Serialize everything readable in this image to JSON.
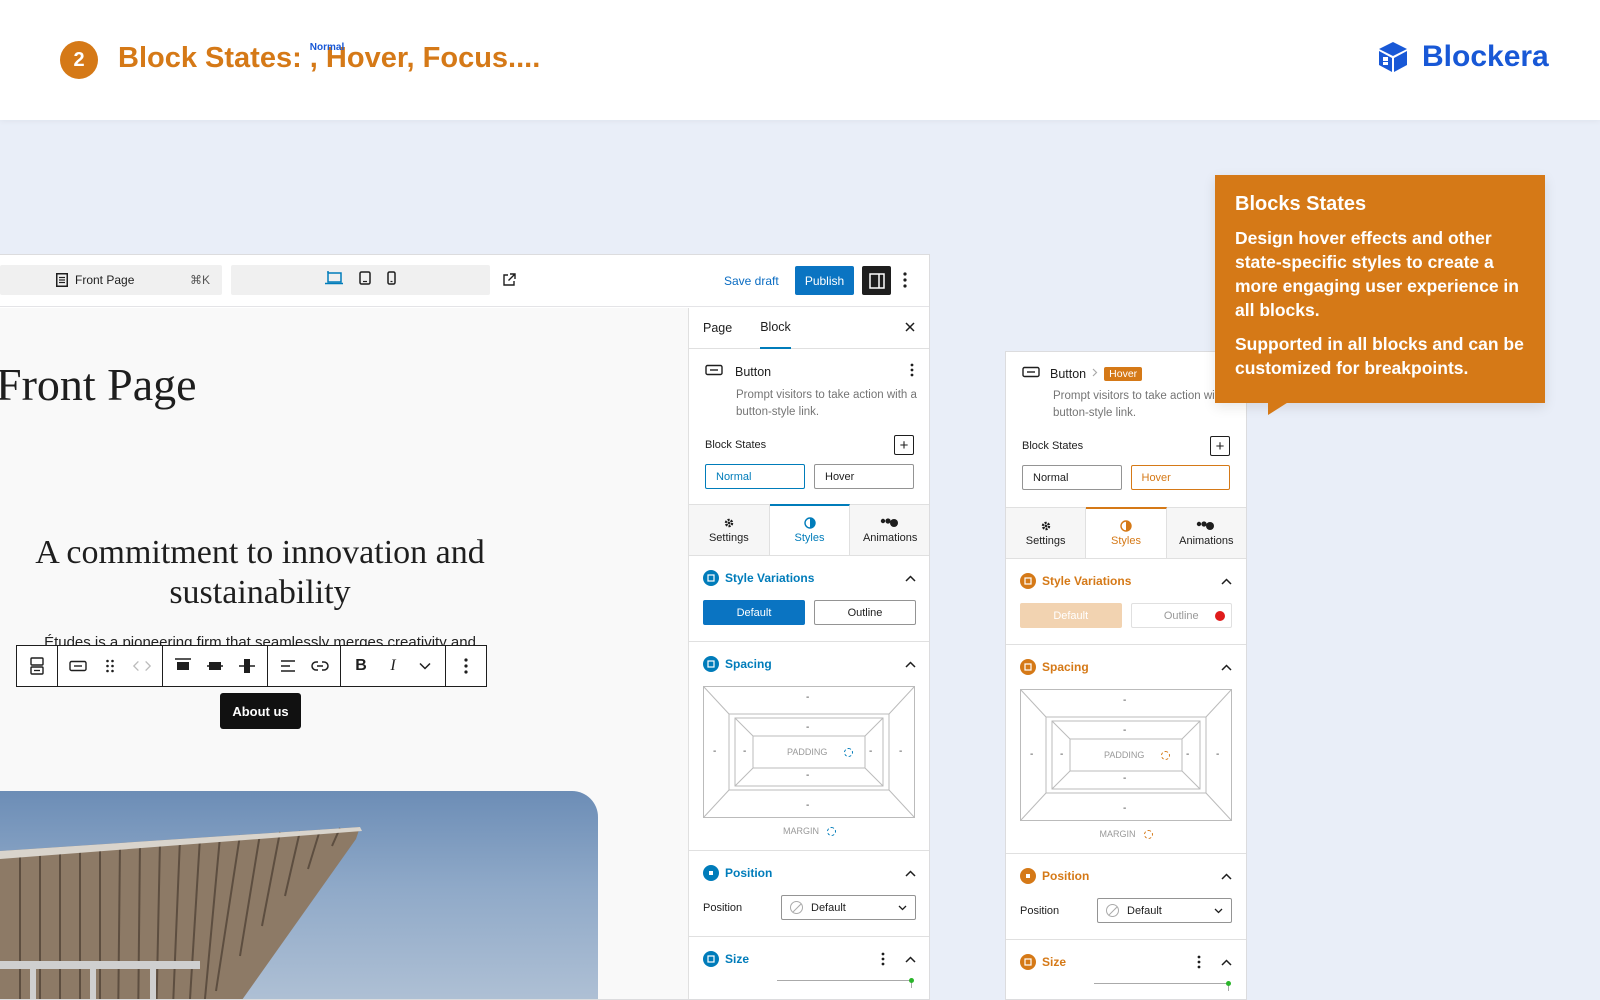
{
  "header": {
    "step": "2",
    "title_prefix": "Block States: ",
    "title_normal": "Normal",
    "comma1": ", ",
    "title_hover": "Hover",
    "comma2": ", ",
    "title_focus": "Focus....",
    "brand": "Blockera"
  },
  "topbar": {
    "command_label": "Front Page",
    "shortcut": "⌘K",
    "save_draft": "Save draft",
    "publish": "Publish"
  },
  "canvas": {
    "page_title": "Front Page",
    "tagline": "A commitment to innovation and sustainability",
    "paragraph": "Études is a pioneering firm that seamlessly merges creativity and",
    "button_label": "About us",
    "toolbar_bold": "B",
    "toolbar_italic": "I"
  },
  "inspector": {
    "tab_page": "Page",
    "tab_block": "Block",
    "block_name": "Button",
    "block_desc": "Prompt visitors to take action with a button-style link.",
    "block_states_label": "Block States",
    "state_normal": "Normal",
    "state_hover": "Hover",
    "tabs": {
      "settings": "Settings",
      "styles": "Styles",
      "animations": "Animations"
    },
    "style_variations": "Style Variations",
    "var_default": "Default",
    "var_outline": "Outline",
    "spacing": "Spacing",
    "dash": "-",
    "padding": "PADDING",
    "margin": "MARGIN",
    "position_section": "Position",
    "position_label": "Position",
    "position_value": "Default",
    "size": "Size"
  },
  "inspector2": {
    "block_name": "Button",
    "state_badge": "Hover",
    "block_desc": "Prompt visitors to take action with a button-style link."
  },
  "callout": {
    "title": "Blocks States",
    "text1": "Design hover effects and other state-specific styles to create a more engaging user experience in all blocks.",
    "text2": "Supported in all blocks and can be customized for breakpoints."
  },
  "colors": {
    "accent_orange": "#d57917",
    "brand_blue": "#1858d6",
    "wp_blue": "#007cba",
    "hover_light": "#f2d3b1"
  }
}
